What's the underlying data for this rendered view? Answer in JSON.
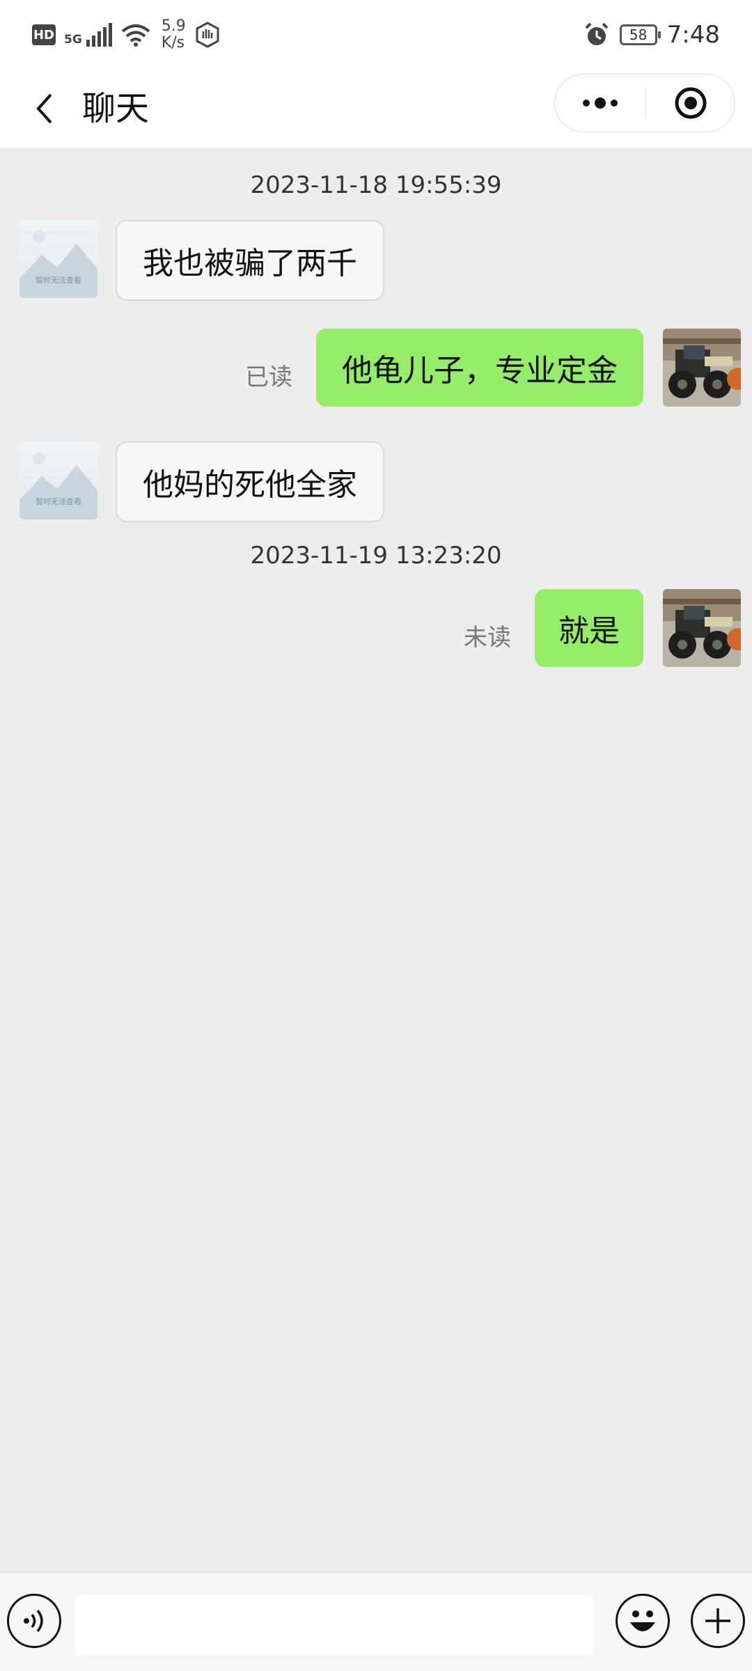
{
  "status_bar": {
    "hd_label": "HD",
    "network_type": "5G",
    "speed_value": "5.9",
    "speed_unit": "K/s",
    "battery_level": "58",
    "time": "7:48"
  },
  "nav": {
    "title": "聊天"
  },
  "colors": {
    "outgoing_bubble": "#95ec69",
    "incoming_bubble": "#f7f7f7",
    "chat_background": "#ededed"
  },
  "messages": [
    {
      "type": "timestamp",
      "text": "2023-11-18 19:55:39"
    },
    {
      "type": "incoming",
      "avatar": "placeholder-image",
      "avatar_text": "暂时无法查看",
      "text": "我也被骗了两千"
    },
    {
      "type": "outgoing",
      "avatar": "wheel-loader-photo",
      "text": "他龟儿子，专业定金",
      "read_status": "已读"
    },
    {
      "type": "incoming",
      "avatar": "placeholder-image",
      "avatar_text": "暂时无法查看",
      "text": "他妈的死他全家"
    },
    {
      "type": "timestamp",
      "text": "2023-11-19 13:23:20"
    },
    {
      "type": "outgoing",
      "avatar": "wheel-loader-photo",
      "text": "就是",
      "read_status": "未读"
    }
  ],
  "input_bar": {
    "value": "",
    "voice_icon": "voice-icon",
    "emoji_icon": "emoji-icon",
    "plus_icon": "plus-icon"
  }
}
